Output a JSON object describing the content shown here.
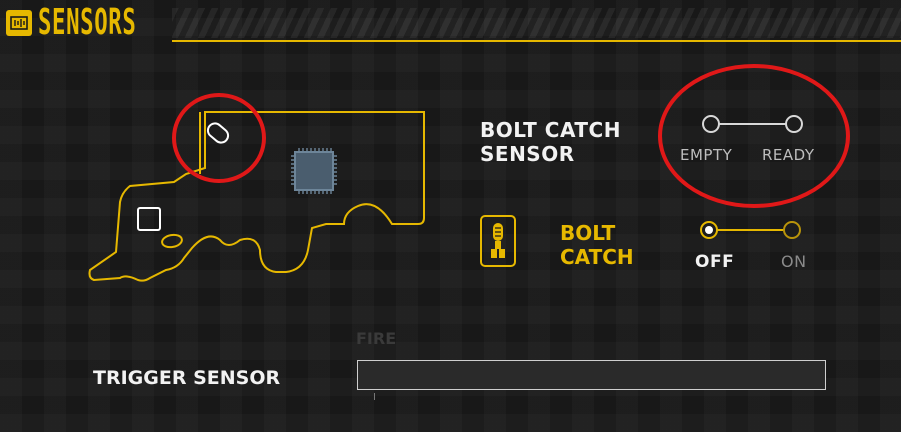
{
  "header": {
    "title": "SENSORS",
    "icon": "sensor-wave-icon"
  },
  "bolt_catch_sensor": {
    "label_line1": "BOLT CATCH",
    "label_line2": "SENSOR",
    "states": [
      "EMPTY",
      "READY"
    ],
    "selected": "none"
  },
  "bolt_catch": {
    "label_line1": "BOLT",
    "label_line2": "CATCH",
    "icon": "bolt-catch-icon",
    "states": [
      "OFF",
      "ON"
    ],
    "selected": "OFF"
  },
  "trigger_sensor": {
    "label": "TRIGGER SENSOR",
    "bar_caption": "FIRE",
    "value": 0
  },
  "colors": {
    "accent": "#e6b800",
    "highlight": "#e01818",
    "text": "#f2f2f2"
  }
}
